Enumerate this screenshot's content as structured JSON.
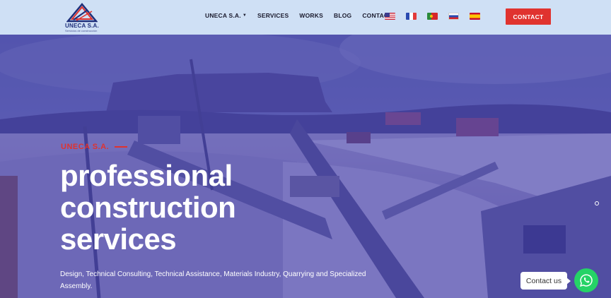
{
  "brand": {
    "name": "UNECA S.A.",
    "subtitle": "Servicios de construcción"
  },
  "nav": {
    "items": [
      {
        "label": "UNECA S.A.",
        "has_dropdown": true
      },
      {
        "label": "SERVICES"
      },
      {
        "label": "WORKS"
      },
      {
        "label": "BLOG"
      },
      {
        "label": "CONTACT"
      }
    ],
    "languages": [
      "us-flag",
      "france-flag",
      "portugal-flag",
      "russia-flag",
      "spain-flag"
    ],
    "cta": "CONTACT"
  },
  "hero": {
    "tagline": "UNECA S.A.",
    "title_lines": [
      "professional",
      "construction",
      "services"
    ],
    "description": "Design, Technical Consulting, Technical Assistance, Materials Industry, Quarrying and Specialized Assembly."
  },
  "chat": {
    "label": "Contact us",
    "icon": "whatsapp-icon"
  },
  "colors": {
    "header_bg": "#cfe0f5",
    "accent": "#e0332f",
    "overlay": "#3c37a5",
    "whatsapp": "#25d366"
  }
}
